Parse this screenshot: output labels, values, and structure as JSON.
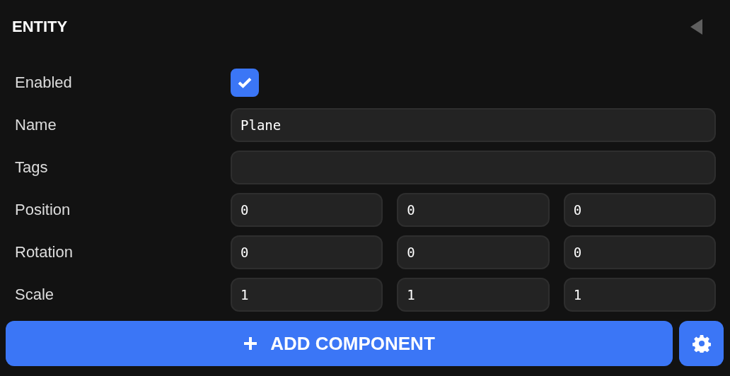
{
  "panel": {
    "title": "ENTITY",
    "collapsed": false
  },
  "rows": [
    {
      "kind": "checkbox",
      "label": "Enabled",
      "checked": true
    },
    {
      "kind": "text",
      "label": "Name",
      "value": "Plane"
    },
    {
      "kind": "text",
      "label": "Tags"
    },
    {
      "kind": "vector",
      "label": "Position",
      "values": [
        "0",
        "0",
        "0"
      ]
    },
    {
      "kind": "vector",
      "label": "Rotation",
      "values": [
        "0",
        "0",
        "0"
      ]
    },
    {
      "kind": "vector",
      "label": "Scale",
      "values": [
        "1",
        "1",
        "1"
      ]
    }
  ],
  "add_button": {
    "label": "ADD COMPONENT"
  }
}
